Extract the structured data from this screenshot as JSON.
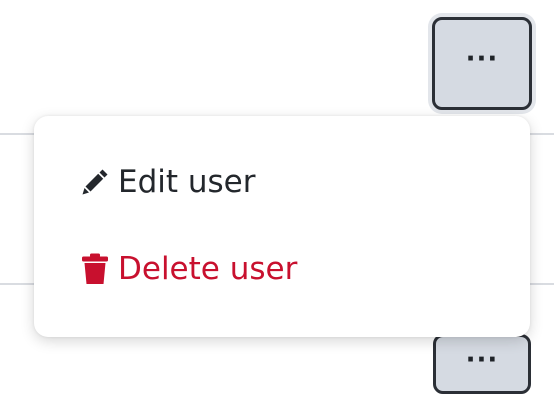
{
  "actions_button": {
    "label": "···"
  },
  "menu": {
    "items": [
      {
        "label": "Edit user",
        "icon": "pencil-icon",
        "color": "#23272c"
      },
      {
        "label": "Delete user",
        "icon": "trash-icon",
        "color": "#c8102e"
      }
    ]
  },
  "next_row_actions_button": {
    "label": "···"
  }
}
